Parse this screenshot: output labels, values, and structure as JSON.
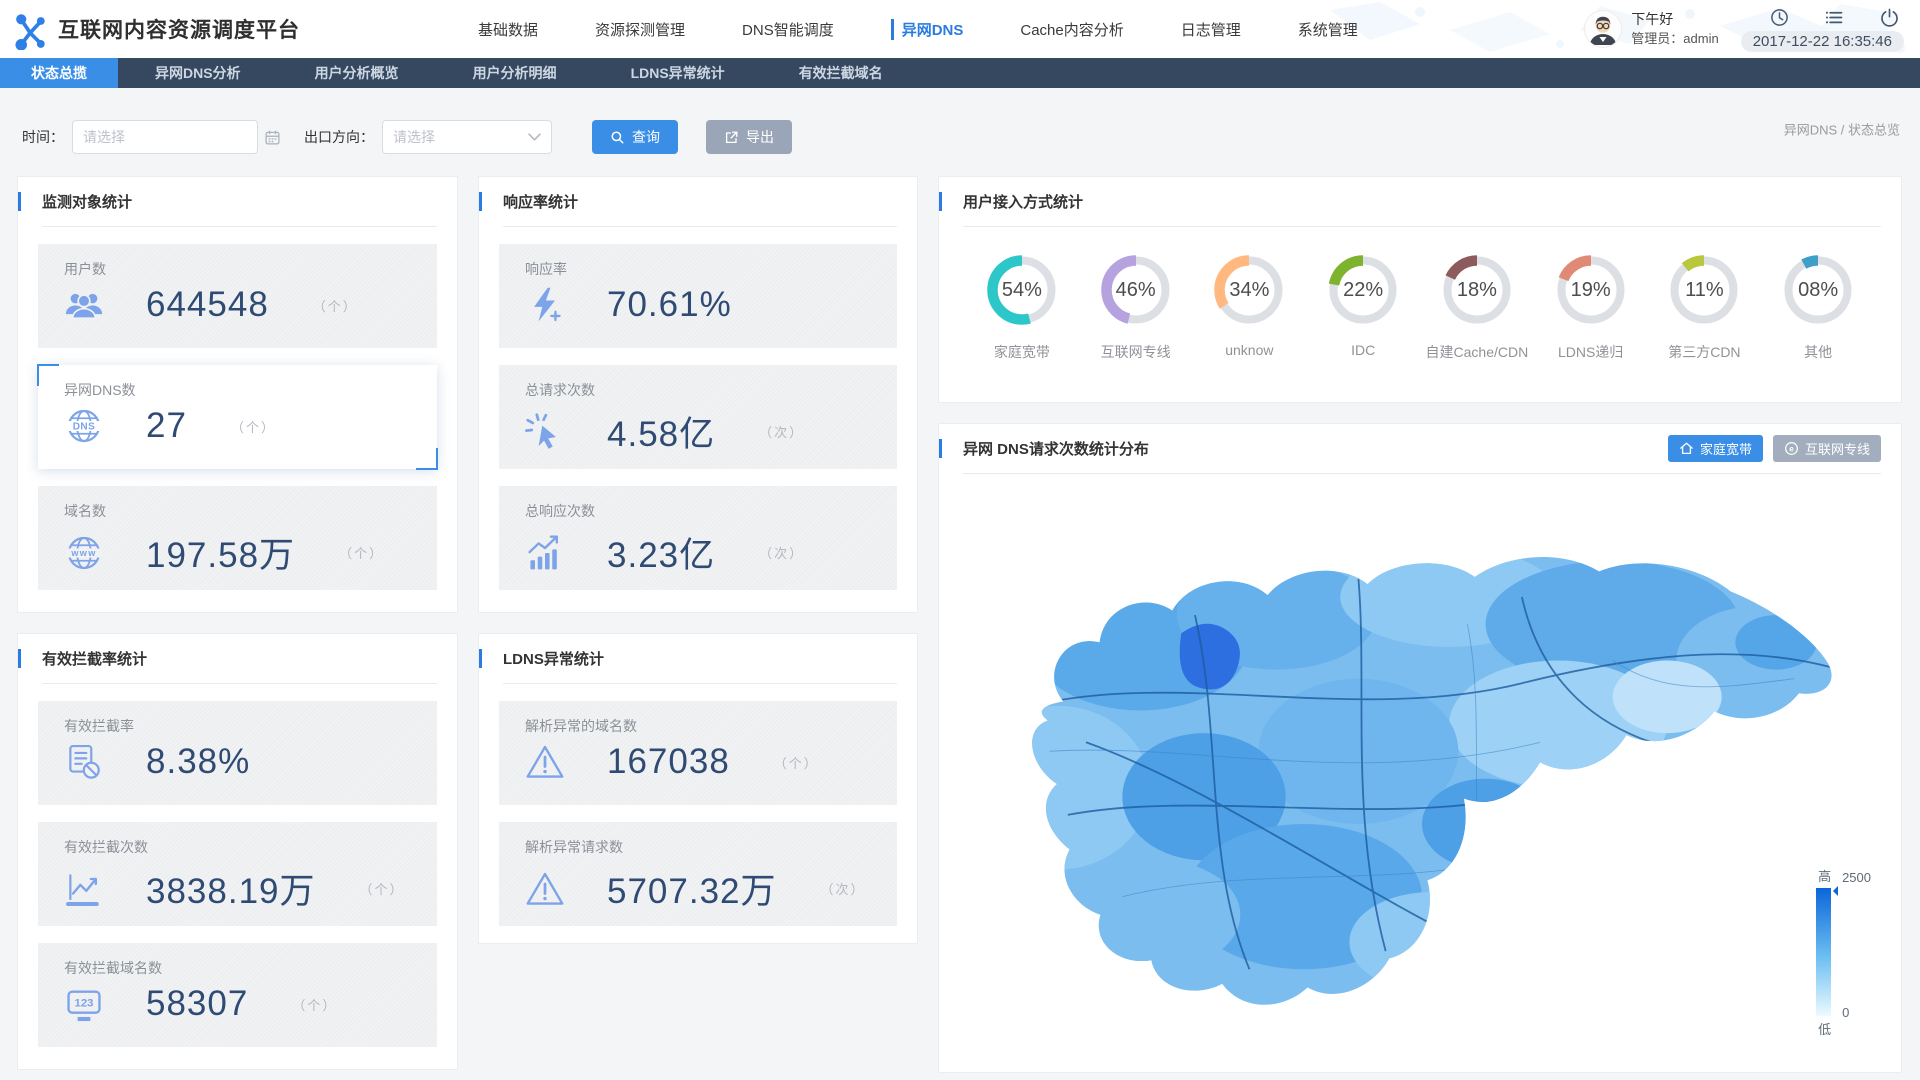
{
  "app": {
    "title": "互联网内容资源调度平台"
  },
  "header": {
    "nav": [
      {
        "label": "基础数据",
        "active": false
      },
      {
        "label": "资源探测管理",
        "active": false
      },
      {
        "label": "DNS智能调度",
        "active": false
      },
      {
        "label": "异网DNS",
        "active": true
      },
      {
        "label": "Cache内容分析",
        "active": false
      },
      {
        "label": "日志管理",
        "active": false
      },
      {
        "label": "系统管理",
        "active": false
      }
    ],
    "greeting": "下午好",
    "admin": "管理员：admin",
    "datetime": "2017-12-22 16:35:46"
  },
  "tabs": [
    {
      "label": "状态总揽",
      "active": true
    },
    {
      "label": "异网DNS分析",
      "active": false
    },
    {
      "label": "用户分析概览",
      "active": false
    },
    {
      "label": "用户分析明细",
      "active": false
    },
    {
      "label": "LDNS异常统计",
      "active": false
    },
    {
      "label": "有效拦截域名",
      "active": false
    }
  ],
  "filters": {
    "time_label": "时间：",
    "time_placeholder": "请选择",
    "direction_label": "出口方向：",
    "direction_placeholder": "请选择",
    "search_label": "查询",
    "export_label": "导出",
    "breadcrumb": "异网DNS / 状态总览"
  },
  "cards": {
    "monitor": {
      "title": "监测对象统计",
      "stats": [
        {
          "label": "用户数",
          "value": "644548",
          "unit": "（个）",
          "icon": "users-icon",
          "highlight": false
        },
        {
          "label": "异网DNS数",
          "value": "27",
          "unit": "（个）",
          "icon": "dns-globe-icon",
          "highlight": true
        },
        {
          "label": "域名数",
          "value": "197.58万",
          "unit": "（个）",
          "icon": "www-globe-icon",
          "highlight": false
        }
      ]
    },
    "response": {
      "title": "响应率统计",
      "stats": [
        {
          "label": "响应率",
          "value": "70.61%",
          "unit": "",
          "icon": "lightning-icon",
          "highlight": false
        },
        {
          "label": "总请求次数",
          "value": "4.58亿",
          "unit": "（次）",
          "icon": "click-icon",
          "highlight": false
        },
        {
          "label": "总响应次数",
          "value": "3.23亿",
          "unit": "（次）",
          "icon": "trend-up-icon",
          "highlight": false
        }
      ]
    },
    "intercept": {
      "title": "有效拦截率统计",
      "stats": [
        {
          "label": "有效拦截率",
          "value": "8.38%",
          "unit": "",
          "icon": "block-doc-icon",
          "highlight": false
        },
        {
          "label": "有效拦截次数",
          "value": "3838.19万",
          "unit": "（个）",
          "icon": "line-chart-icon",
          "highlight": false
        },
        {
          "label": "有效拦截域名数",
          "value": "58307",
          "unit": "（个）",
          "icon": "monitor-123-icon",
          "highlight": false
        }
      ]
    },
    "ldns": {
      "title": "LDNS异常统计",
      "stats": [
        {
          "label": "解析异常的域名数",
          "value": "167038",
          "unit": "（个）",
          "icon": "warning-icon",
          "highlight": false
        },
        {
          "label": "解析异常请求数",
          "value": "5707.32万",
          "unit": "（次）",
          "icon": "warning-icon",
          "highlight": false
        }
      ]
    },
    "access": {
      "title": "用户接入方式统计"
    },
    "map": {
      "title": "异网 DNS请求次数统计分布",
      "buttons": [
        {
          "label": "家庭宽带",
          "active": true,
          "icon": "home-icon"
        },
        {
          "label": "互联网专线",
          "active": false,
          "icon": "browser-icon"
        }
      ],
      "legend": {
        "high": "高",
        "low": "低",
        "max": "2500",
        "min": "0"
      }
    }
  },
  "chart_data": [
    {
      "type": "pie",
      "title": "用户接入方式统计",
      "categories": [
        "家庭宽带",
        "互联网专线",
        "unknow",
        "IDC",
        "自建Cache/CDN",
        "LDNS递归",
        "第三方CDN",
        "其他"
      ],
      "values": [
        54,
        46,
        34,
        22,
        18,
        19,
        11,
        8
      ],
      "display": [
        "54%",
        "46%",
        "34%",
        "22%",
        "18%",
        "19%",
        "11%",
        "08%"
      ],
      "colors": [
        "#2ec7c9",
        "#b6a2de",
        "#ffb980",
        "#7eb32d",
        "#8d5b5b",
        "#e08a75",
        "#b8c73c",
        "#3e9fc9"
      ],
      "legend_position": "below-each",
      "style": "donut"
    },
    {
      "type": "heatmap",
      "title": "异网 DNS请求次数统计分布",
      "region": "山东省",
      "value_range": [
        0,
        2500
      ],
      "legend_high_label": "高",
      "legend_low_label": "低",
      "series_toggles": [
        "家庭宽带",
        "互联网专线"
      ],
      "active_toggle": "家庭宽带"
    }
  ],
  "colors": {
    "accent": "#3a8ee6",
    "tab_bar_bg": "#35485f",
    "stat_value": "#2f4b73",
    "stat_icon": "#7da3e8",
    "map_high": "#0a66d9",
    "map_low": "#ecfaff",
    "export_button": "#9aa6b7"
  }
}
